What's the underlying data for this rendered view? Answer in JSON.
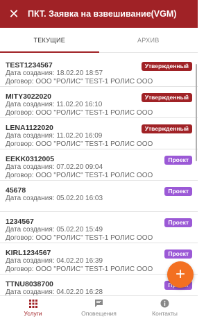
{
  "header": {
    "title": "ПКТ. Заявка на взвешивание(VGM)",
    "close_icon": "close-icon"
  },
  "tabs": [
    {
      "label": "ТЕКУЩИЕ",
      "active": true
    },
    {
      "label": "АРХИВ",
      "active": false
    }
  ],
  "items": [
    {
      "code": "TEST1234567",
      "date": "Дата создания: 18.02.20 18:57",
      "contract": "Договор: ООО \"РОЛИС\" TEST-1 РОЛИС ООО",
      "status": "Утвержденный",
      "status_type": "approved"
    },
    {
      "code": "MITY3022020",
      "date": "Дата создания: 11.02.20 16:10",
      "contract": "Договор: ООО \"РОЛИС\" TEST-1 РОЛИС ООО",
      "status": "Утвержденный",
      "status_type": "approved"
    },
    {
      "code": "LENA1122020",
      "date": "Дата создания: 11.02.20 16:09",
      "contract": "Договор: ООО \"РОЛИС\" TEST-1 РОЛИС ООО",
      "status": "Утвержденный",
      "status_type": "approved"
    },
    {
      "code": "EEKK0312005",
      "date": "Дата создания: 07.02.20 09:04",
      "contract": "Договор: ООО \"РОЛИС\" TEST-1 РОЛИС ООО",
      "status": "Проект",
      "status_type": "project"
    },
    {
      "code": "45678",
      "date": "Дата создания: 05.02.20 16:03",
      "contract": "",
      "status": "Проект",
      "status_type": "project"
    },
    {
      "code": "1234567",
      "date": "Дата создания: 05.02.20 15:49",
      "contract": "Договор: ООО \"РОЛИС\" TEST-1 РОЛИС ООО",
      "status": "Проект",
      "status_type": "project"
    },
    {
      "code": "KIRL1234567",
      "date": "Дата создания: 04.02.20 16:39",
      "contract": "Договор: ООО \"РОЛИС\" TEST-1 РОЛИС ООО",
      "status": "Проект",
      "status_type": "project"
    },
    {
      "code": "TTNU8038700",
      "date": "Дата создания: 04.02.20 16:28",
      "contract": "",
      "status": "Проект",
      "status_type": "project"
    }
  ],
  "fab": {
    "label": "+"
  },
  "bottom_nav": [
    {
      "label": "Услуги",
      "icon": "grid-icon",
      "active": true
    },
    {
      "label": "Оповещения",
      "icon": "message-icon",
      "active": false
    },
    {
      "label": "Контакты",
      "icon": "info-icon",
      "active": false
    }
  ],
  "colors": {
    "primary": "#a02226",
    "approved": "#a02226",
    "project": "#9b59d6",
    "fab": "#f37021"
  }
}
